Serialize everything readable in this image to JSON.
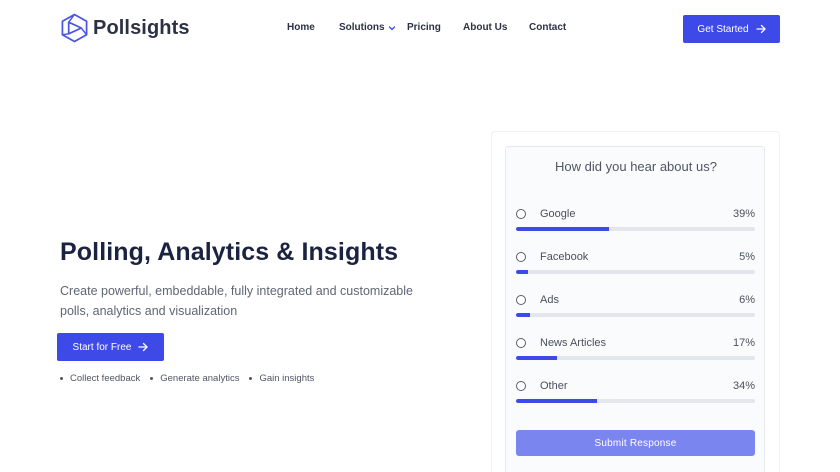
{
  "brand": {
    "name": "Pollsights",
    "logo_icon": "pollsights-logo-icon",
    "accent": "#3d4ae8"
  },
  "nav": {
    "items": [
      {
        "label": "Home"
      },
      {
        "label": "Solutions",
        "icon": "chevron-down-icon"
      },
      {
        "label": "Pricing"
      },
      {
        "label": "About Us"
      },
      {
        "label": "Contact"
      }
    ],
    "cta_label": "Get Started",
    "cta_icon": "arrow-right-icon"
  },
  "hero": {
    "title": "Polling, Analytics & Insights",
    "subtitle": "Create powerful, embeddable, fully integrated and customizable polls, analytics and visualization",
    "cta_label": "Start for Free",
    "cta_icon": "arrow-right-icon",
    "features": [
      "Collect feedback",
      "Generate analytics",
      "Gain insights"
    ]
  },
  "poll": {
    "question": "How did you hear about us?",
    "options": [
      {
        "label": "Google",
        "percent_text": "39%",
        "percent": 39
      },
      {
        "label": "Facebook",
        "percent_text": "5%",
        "percent": 5
      },
      {
        "label": "Ads",
        "percent_text": "6%",
        "percent": 6
      },
      {
        "label": "News Articles",
        "percent_text": "17%",
        "percent": 17
      },
      {
        "label": "Other",
        "percent_text": "34%",
        "percent": 34
      }
    ],
    "submit_label": "Submit Response",
    "bar_color": "#3d4ae8",
    "submit_color": "#7b85f0"
  }
}
